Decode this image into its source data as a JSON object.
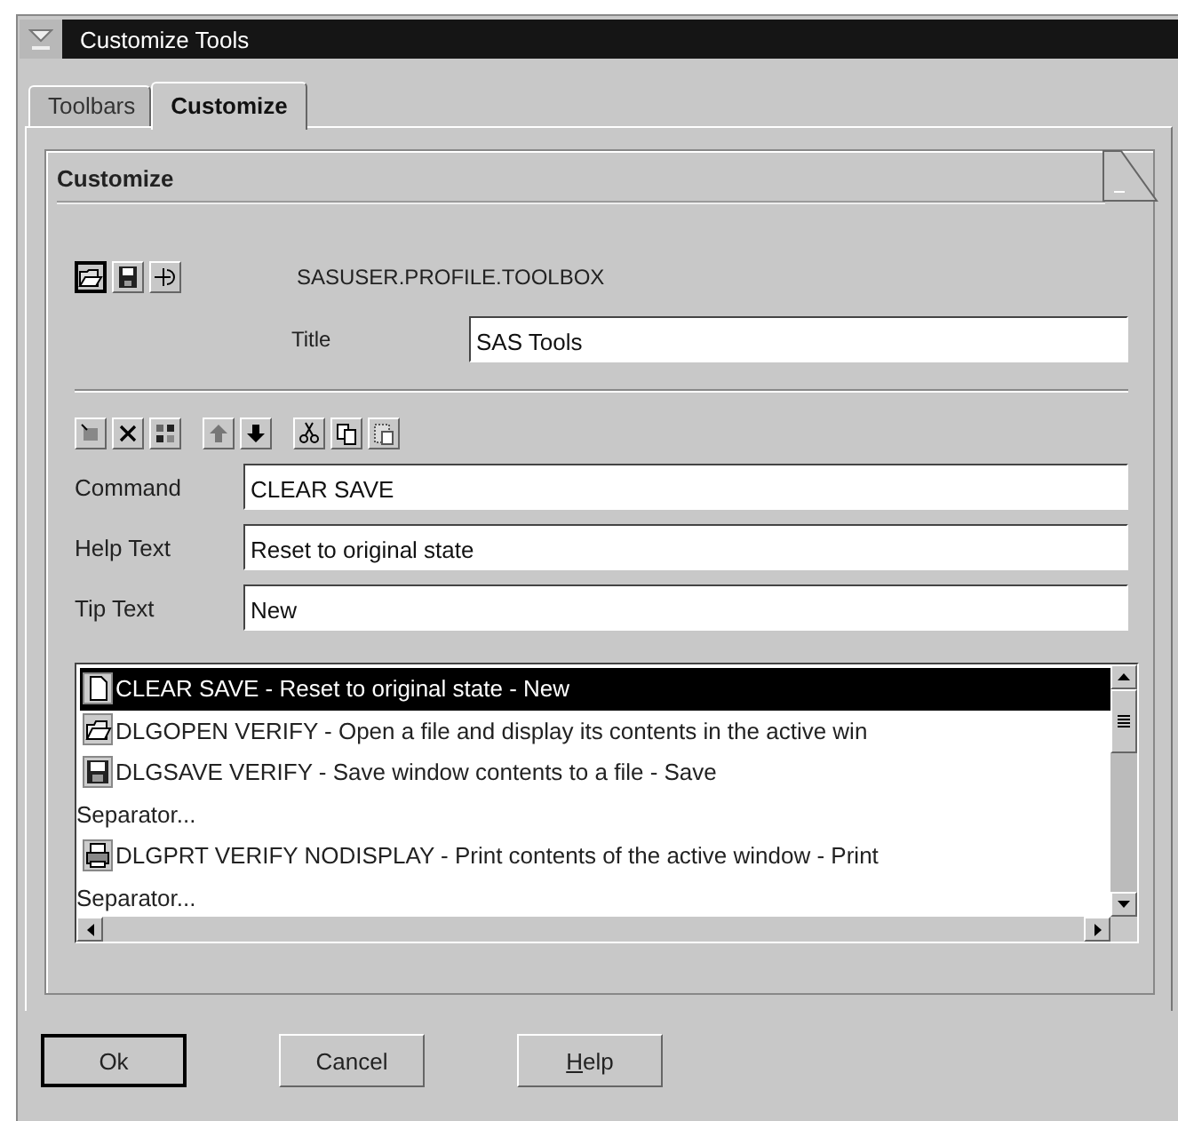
{
  "window": {
    "title": "Customize Tools"
  },
  "tabs": [
    {
      "label": "Toolbars",
      "selected": false
    },
    {
      "label": "Customize",
      "selected": true
    }
  ],
  "group": {
    "title": "Customize"
  },
  "toolbox_name": "SASUSER.PROFILE.TOOLBOX",
  "title_field": {
    "label": "Title",
    "value": "SAS Tools"
  },
  "fields": [
    {
      "label": "Command",
      "value": "CLEAR SAVE"
    },
    {
      "label": "Help Text",
      "value": "Reset to original state"
    },
    {
      "label": "Tip Text",
      "value": "New"
    }
  ],
  "tools": [
    {
      "kind": "command",
      "text": "CLEAR SAVE - Reset to original state - New",
      "selected": true
    },
    {
      "kind": "command",
      "text": "DLGOPEN VERIFY - Open a file and display its contents in the active win",
      "selected": false
    },
    {
      "kind": "command",
      "text": "DLGSAVE VERIFY - Save window contents to a file - Save",
      "selected": false
    },
    {
      "kind": "separator",
      "text": "Separator...",
      "selected": false
    },
    {
      "kind": "command",
      "text": "DLGPRT VERIFY NODISPLAY - Print contents of the active window - Print",
      "selected": false
    },
    {
      "kind": "separator",
      "text": "Separator...",
      "selected": false
    }
  ],
  "buttons": [
    {
      "label": "Ok",
      "default": true,
      "underline_first": false
    },
    {
      "label": "Cancel",
      "default": false,
      "underline_first": false
    },
    {
      "label": "Help",
      "default": false,
      "underline_first": true
    }
  ]
}
